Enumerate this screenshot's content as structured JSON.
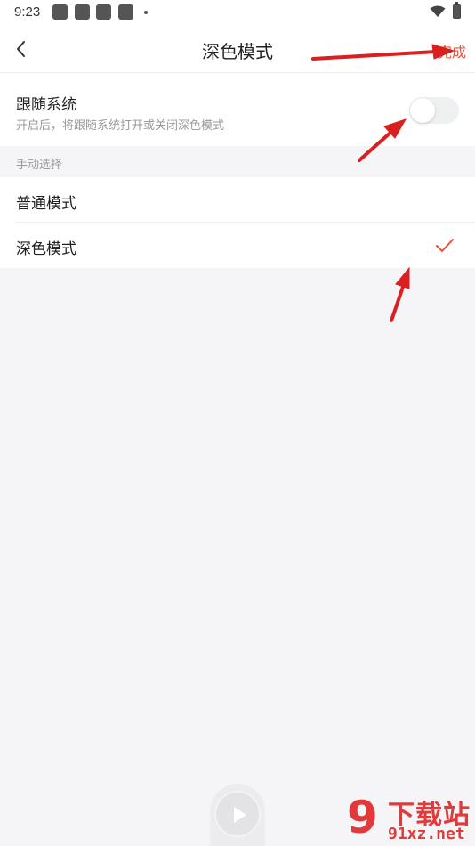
{
  "status_bar": {
    "time": "9:23"
  },
  "nav": {
    "title": "深色模式",
    "done_label": "完成"
  },
  "follow_system": {
    "title": "跟随系统",
    "description": "开启后，将跟随系统打开或关闭深色模式",
    "enabled": false
  },
  "manual": {
    "section_label": "手动选择",
    "options": [
      {
        "label": "普通模式",
        "selected": false
      },
      {
        "label": "深色模式",
        "selected": true
      }
    ]
  },
  "colors": {
    "accent": "#e8523f",
    "arrow": "#d91f1f",
    "background": "#f5f5f7"
  },
  "icons": {
    "back": "chevron-left-icon",
    "check": "check-icon",
    "wifi": "wifi-icon",
    "battery": "battery-icon",
    "play": "play-icon"
  },
  "watermark": {
    "logo": "9",
    "site_name": "下载站",
    "url": "91xz.net"
  }
}
